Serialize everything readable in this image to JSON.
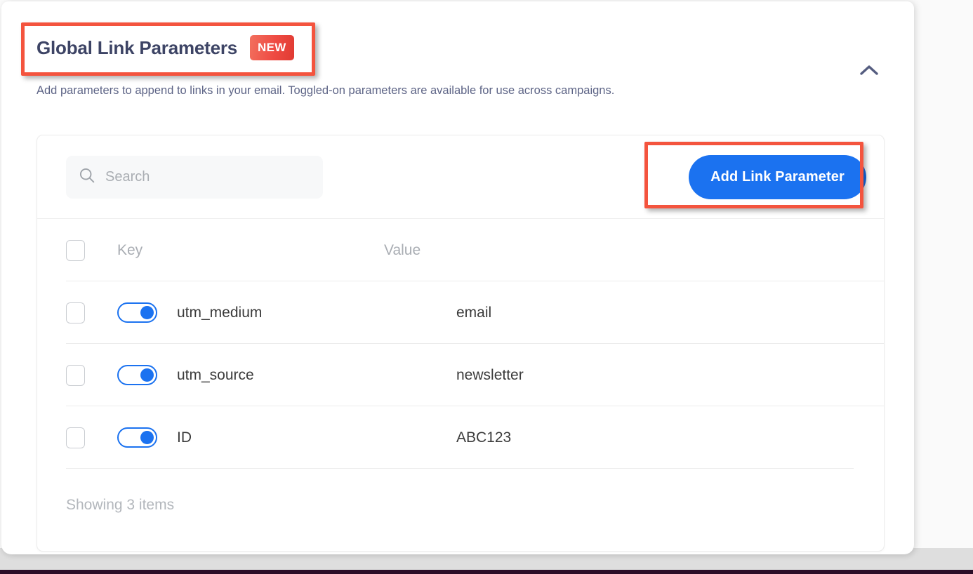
{
  "panel": {
    "title": "Global Link Parameters",
    "badge": "NEW",
    "subtitle": "Add parameters to append to links in your email. Toggled-on parameters are available for use across campaigns.",
    "collapse_icon": "chevron-up-icon",
    "accent_color": "#1b72f0",
    "badge_color": "#ef4b43",
    "annotation_color": "#f4543e"
  },
  "toolbar": {
    "search_placeholder": "Search",
    "search_value": "",
    "search_icon": "search-icon",
    "add_button_label": "Add Link Parameter"
  },
  "table": {
    "columns": [
      "Key",
      "Value"
    ],
    "rows": [
      {
        "key": "utm_medium",
        "value": "email",
        "enabled": true,
        "selected": false
      },
      {
        "key": "utm_source",
        "value": "newsletter",
        "enabled": true,
        "selected": false
      },
      {
        "key": "ID",
        "value": "ABC123",
        "enabled": true,
        "selected": false
      }
    ],
    "select_all": false
  },
  "footer": {
    "status": "Showing 3 items"
  }
}
